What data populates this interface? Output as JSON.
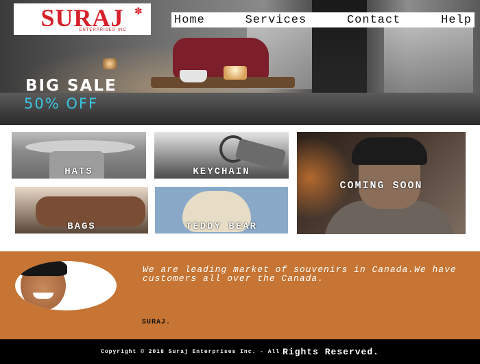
{
  "header": {
    "logo_text": "SURAJ",
    "logo_subtext": "ENTERPRISES INC",
    "nav": [
      "Home",
      "Services",
      "Contact",
      "Help"
    ]
  },
  "hero": {
    "headline": "BIG SALE",
    "subheadline": "50% OFF",
    "subheadline_color": "#39c5e0"
  },
  "products": {
    "hats": "HATS",
    "keychain": "KEYCHAIN",
    "bags": "BAGS",
    "teddy": "TEDDY BEAR",
    "coming_soon": "COMING SOON"
  },
  "about": {
    "background_color": "#c77534",
    "text": "We are leading market of souvenirs in Canada.We have customers all over the Canada.",
    "signature": "SURAJ."
  },
  "footer": {
    "copyright_small": "Copyright © 2018 Suraj Enterprises Inc. - All",
    "copyright_big": "Rights Reserved."
  }
}
